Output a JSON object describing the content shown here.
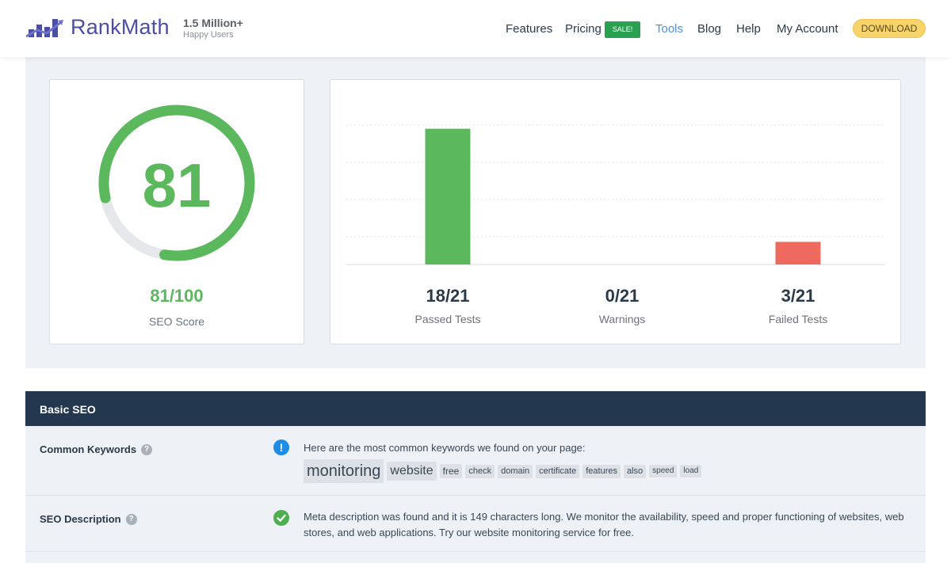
{
  "header": {
    "brand": "RankMath",
    "users_count": "1.5 Million+",
    "users_sub": "Happy Users",
    "nav": [
      "Features",
      "Pricing",
      "Tools",
      "Blog",
      "Help",
      "My Account"
    ],
    "sale_badge": "SALE!",
    "download": "DOWNLOAD",
    "active_nav": "Tools"
  },
  "score": {
    "value": "81",
    "fraction": "81/100",
    "label": "SEO Score",
    "percent": 81
  },
  "tests": {
    "passed": {
      "value": "18/21",
      "label": "Passed Tests"
    },
    "warnings": {
      "value": "0/21",
      "label": "Warnings"
    },
    "failed": {
      "value": "3/21",
      "label": "Failed Tests"
    }
  },
  "chart_data": {
    "type": "bar",
    "categories": [
      "Passed Tests",
      "Warnings",
      "Failed Tests"
    ],
    "values": [
      18,
      0,
      3
    ],
    "ylim": [
      0,
      21
    ],
    "colors": [
      "#5cb85c",
      "#f0ad4e",
      "#ee6a5f"
    ],
    "grid": true
  },
  "section": {
    "title": "Basic SEO",
    "rows": [
      {
        "label": "Common Keywords",
        "text": "Here are the most common keywords we found on your page:",
        "keywords": [
          "monitoring",
          "website",
          "free",
          "check",
          "domain",
          "certificate",
          "features",
          "also",
          "speed",
          "load"
        ]
      },
      {
        "label": "SEO Description",
        "text": "Meta description was found and it is 149 characters long. We monitor the availability, speed and proper functioning of websites, web stores, and web applications. Try our website monitoring service for free."
      }
    ]
  },
  "colors": {
    "brand": "#4b4ea2",
    "pass": "#5cb85c",
    "fail": "#ee6a5f",
    "section_header": "#23374f",
    "download": "#f7d36b"
  }
}
